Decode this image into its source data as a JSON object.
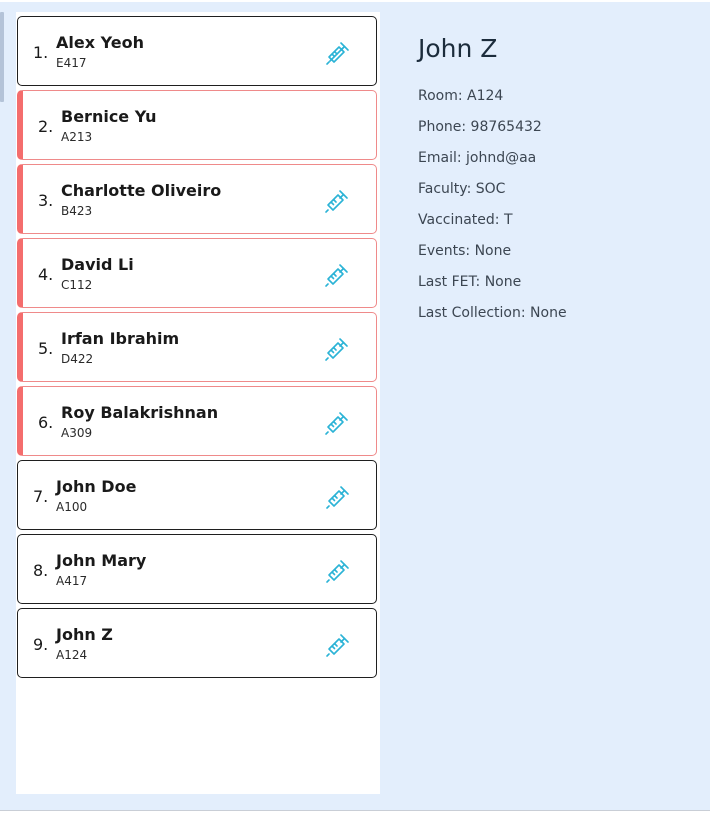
{
  "persons": [
    {
      "index": "1.",
      "name": "Alex Yeoh",
      "room": "E417",
      "flagged": false,
      "vaccinated": true
    },
    {
      "index": "2.",
      "name": "Bernice Yu",
      "room": "A213",
      "flagged": true,
      "vaccinated": false
    },
    {
      "index": "3.",
      "name": "Charlotte Oliveiro",
      "room": "B423",
      "flagged": true,
      "vaccinated": true
    },
    {
      "index": "4.",
      "name": "David Li",
      "room": "C112",
      "flagged": true,
      "vaccinated": true
    },
    {
      "index": "5.",
      "name": "Irfan Ibrahim",
      "room": "D422",
      "flagged": true,
      "vaccinated": true
    },
    {
      "index": "6.",
      "name": "Roy Balakrishnan",
      "room": "A309",
      "flagged": true,
      "vaccinated": true
    },
    {
      "index": "7.",
      "name": "John Doe",
      "room": "A100",
      "flagged": false,
      "vaccinated": true
    },
    {
      "index": "8.",
      "name": "John Mary",
      "room": "A417",
      "flagged": false,
      "vaccinated": true
    },
    {
      "index": "9.",
      "name": "John Z",
      "room": "A124",
      "flagged": false,
      "vaccinated": true
    }
  ],
  "vaccinated_icon": "syringe-icon",
  "flag_color": "#f46d6d",
  "icon_color": "#2bb3d6",
  "detail": {
    "name": "John Z",
    "room": "Room: A124",
    "phone": "Phone: 98765432",
    "email": "Email: johnd@aa",
    "faculty": "Faculty: SOC",
    "vaccinated": "Vaccinated: T",
    "events": "Events: None",
    "last_fet": "Last FET: None",
    "last_collection": "Last Collection: None"
  }
}
